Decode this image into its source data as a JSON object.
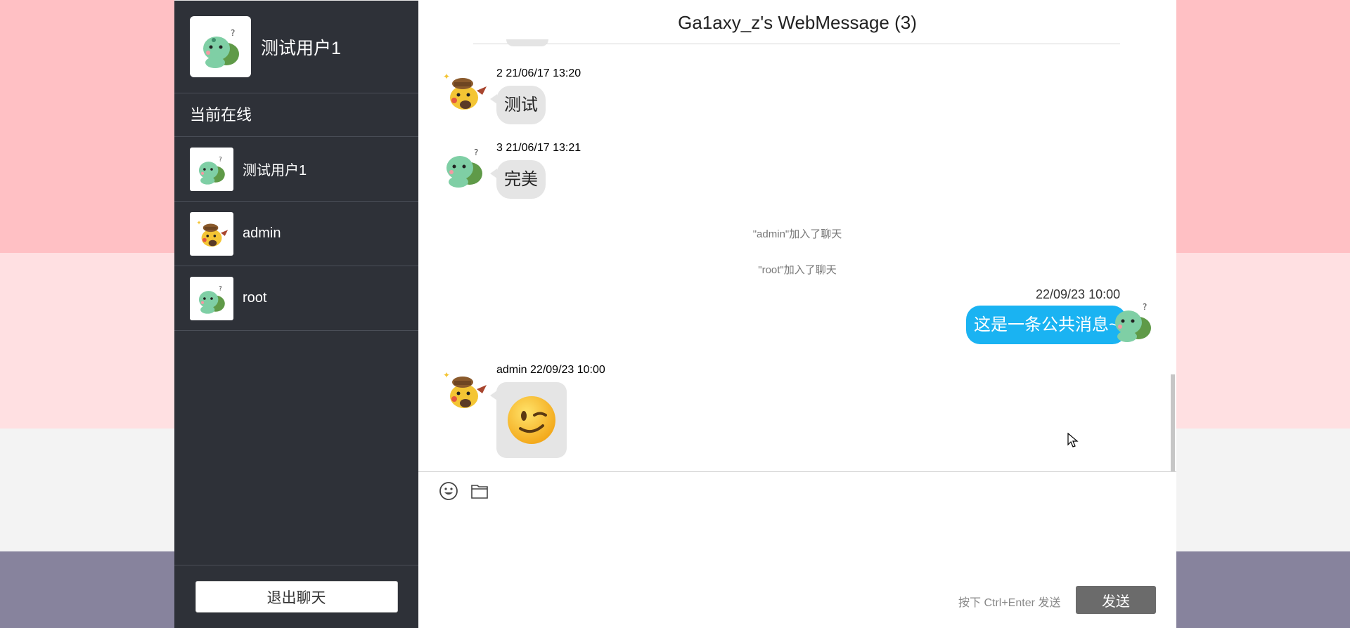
{
  "window": {
    "title": "Ga1axy_z's WebMessage (3)"
  },
  "sidebar": {
    "current_user": {
      "name": "测试用户1",
      "avatar": "bulbasaur-avatar"
    },
    "online_title": "当前在线",
    "users": [
      {
        "name": "测试用户1",
        "avatar": "bulbasaur-avatar"
      },
      {
        "name": "admin",
        "avatar": "pikachu-avatar"
      },
      {
        "name": "root",
        "avatar": "bulbasaur-avatar"
      }
    ],
    "logout_label": "退出聊天"
  },
  "messages": [
    {
      "meta": "2 21/06/17 13:20",
      "text": "测试",
      "avatar": "pikachu-avatar",
      "side": "left"
    },
    {
      "meta": "3 21/06/17 13:21",
      "text": "完美",
      "avatar": "bulbasaur-avatar",
      "side": "left"
    },
    {
      "system": "\"admin\"加入了聊天"
    },
    {
      "system": "\"root\"加入了聊天"
    },
    {
      "meta": "22/09/23 10:00",
      "text": "这是一条公共消息~",
      "avatar": "bulbasaur-avatar",
      "side": "right"
    },
    {
      "meta": "admin 22/09/23 10:00",
      "emoji": "wink-emoji",
      "avatar": "pikachu-avatar",
      "side": "left"
    }
  ],
  "input": {
    "hint": "按下 Ctrl+Enter 发送",
    "send_label": "发送",
    "tools": [
      "emoji-icon",
      "folder-icon"
    ]
  },
  "colors": {
    "sidebar": "#2e3138",
    "bubble_self": "#1ab3f2",
    "bubble_other": "#e5e5e5",
    "send_button": "#6b6b6b"
  }
}
